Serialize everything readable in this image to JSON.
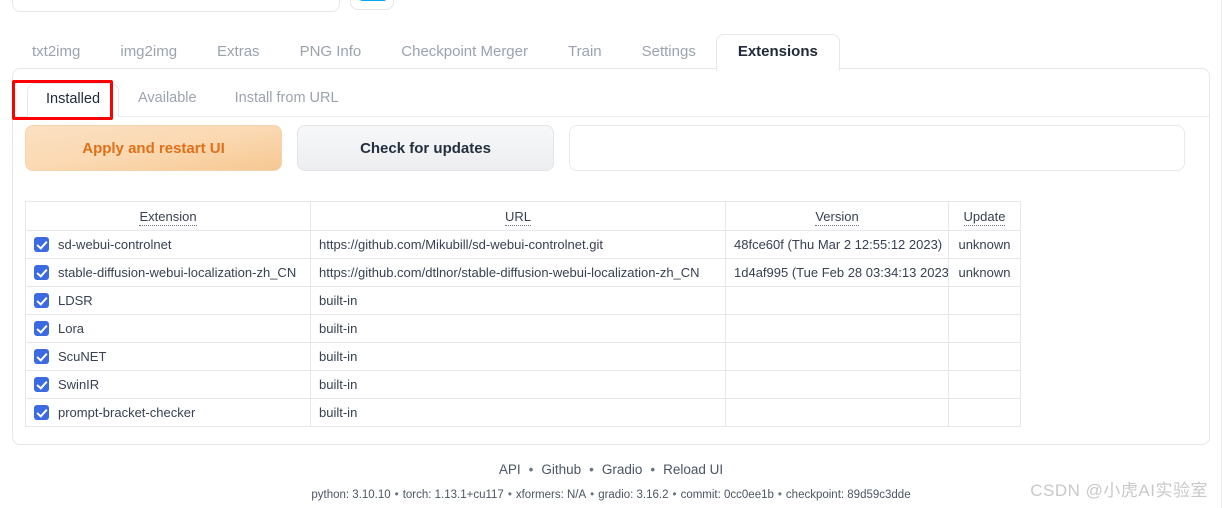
{
  "app": {
    "main_tabs": [
      {
        "label": "txt2img",
        "active": false
      },
      {
        "label": "img2img",
        "active": false
      },
      {
        "label": "Extras",
        "active": false
      },
      {
        "label": "PNG Info",
        "active": false
      },
      {
        "label": "Checkpoint Merger",
        "active": false
      },
      {
        "label": "Train",
        "active": false
      },
      {
        "label": "Settings",
        "active": false
      },
      {
        "label": "Extensions",
        "active": true
      }
    ],
    "sub_tabs": [
      {
        "label": "Installed",
        "active": true
      },
      {
        "label": "Available",
        "active": false
      },
      {
        "label": "Install from URL",
        "active": false
      }
    ]
  },
  "actions": {
    "apply_label": "Apply and restart UI",
    "check_label": "Check for updates",
    "output_value": "",
    "output_placeholder": ""
  },
  "table": {
    "headers": [
      "Extension",
      "URL",
      "Version",
      "Update"
    ],
    "rows": [
      {
        "checked": true,
        "extension": "sd-webui-controlnet",
        "url": "https://github.com/Mikubill/sd-webui-controlnet.git",
        "version": "48fce60f (Thu Mar 2 12:55:12 2023)",
        "update": "unknown"
      },
      {
        "checked": true,
        "extension": "stable-diffusion-webui-localization-zh_CN",
        "url": "https://github.com/dtlnor/stable-diffusion-webui-localization-zh_CN",
        "version": "1d4af995 (Tue Feb 28 03:34:13 2023)",
        "update": "unknown"
      },
      {
        "checked": true,
        "extension": "LDSR",
        "url": "built-in",
        "version": "",
        "update": ""
      },
      {
        "checked": true,
        "extension": "Lora",
        "url": "built-in",
        "version": "",
        "update": ""
      },
      {
        "checked": true,
        "extension": "ScuNET",
        "url": "built-in",
        "version": "",
        "update": ""
      },
      {
        "checked": true,
        "extension": "SwinIR",
        "url": "built-in",
        "version": "",
        "update": ""
      },
      {
        "checked": true,
        "extension": "prompt-bracket-checker",
        "url": "built-in",
        "version": "",
        "update": ""
      }
    ]
  },
  "footer": {
    "links": [
      "API",
      "Github",
      "Gradio",
      "Reload UI"
    ],
    "separator": "•",
    "meta": [
      "python: 3.10.10",
      "torch: 1.13.1+cu117",
      "xformers: N/A",
      "gradio: 3.16.2",
      "commit: 0cc0ee1b",
      "checkpoint: 89d59c3dde"
    ]
  },
  "watermark": {
    "text": "CSDN @小虎AI实验室"
  },
  "colors": {
    "accent_orange": "#e0701a",
    "checkbox_blue": "#3b6ae1",
    "annotation_red": "#ff0000",
    "top_button_blue": "#06a6f5"
  }
}
